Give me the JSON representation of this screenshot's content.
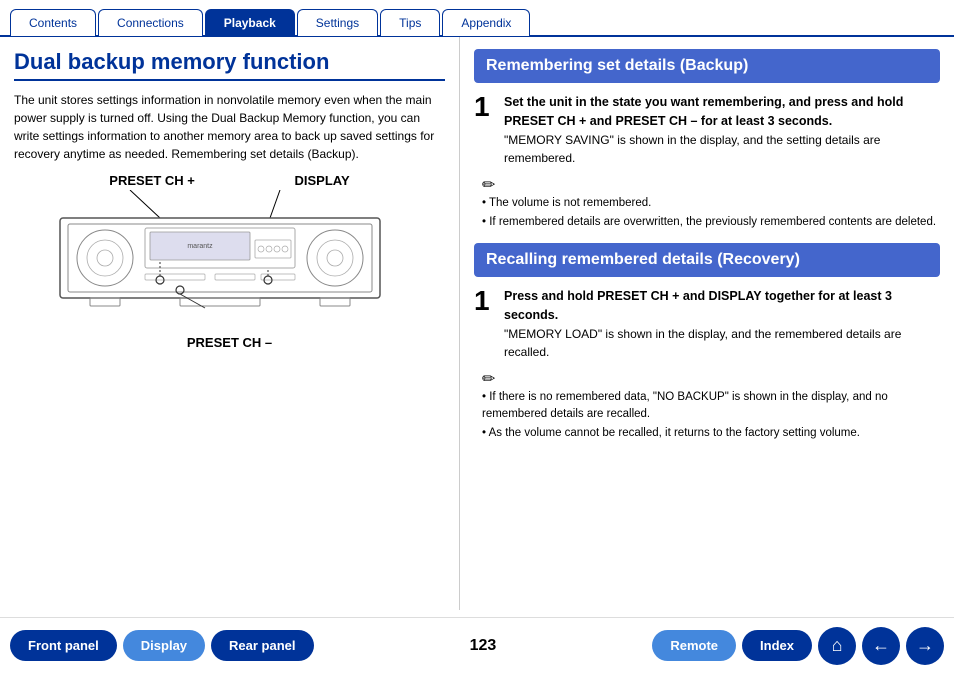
{
  "tabs": [
    {
      "label": "Contents",
      "active": false
    },
    {
      "label": "Connections",
      "active": false
    },
    {
      "label": "Playback",
      "active": true
    },
    {
      "label": "Settings",
      "active": false
    },
    {
      "label": "Tips",
      "active": false
    },
    {
      "label": "Appendix",
      "active": false
    }
  ],
  "page": {
    "title": "Dual backup memory function",
    "intro": "The unit stores settings information in nonvolatile memory even when the main power supply is turned off. Using the Dual Backup Memory function, you can write settings information to another memory area to back up saved settings for recovery anytime as needed. Remembering set details (Backup).",
    "diagram": {
      "label_preset_ch_plus": "PRESET CH +",
      "label_display": "DISPLAY",
      "label_preset_ch_minus": "PRESET CH –"
    }
  },
  "sections": {
    "backup": {
      "header": "Remembering set details (Backup)",
      "step1": {
        "number": "1",
        "instruction": "Set the unit in the state you want remembering, and press and hold PRESET CH + and PRESET CH – for at least 3 seconds.",
        "detail": "\"MEMORY SAVING\" is shown in the display, and the setting details are remembered."
      },
      "notes": [
        "The volume is not remembered.",
        "If remembered details are overwritten, the previously remembered contents are deleted."
      ]
    },
    "recovery": {
      "header": "Recalling remembered details (Recovery)",
      "step1": {
        "number": "1",
        "instruction": "Press and hold PRESET CH + and DISPLAY together for at least 3 seconds.",
        "detail": "\"MEMORY LOAD\" is shown in the display, and the remembered details are recalled."
      },
      "notes": [
        "If there is no remembered data, \"NO BACKUP\" is shown in the display, and no remembered details are recalled.",
        "As the volume cannot be recalled, it returns to the factory setting volume."
      ]
    }
  },
  "footer": {
    "page_number": "123",
    "buttons": {
      "front_panel": "Front panel",
      "display": "Display",
      "rear_panel": "Rear panel",
      "remote": "Remote",
      "index": "Index"
    },
    "icons": {
      "home": "⌂",
      "back": "←",
      "forward": "→"
    }
  }
}
